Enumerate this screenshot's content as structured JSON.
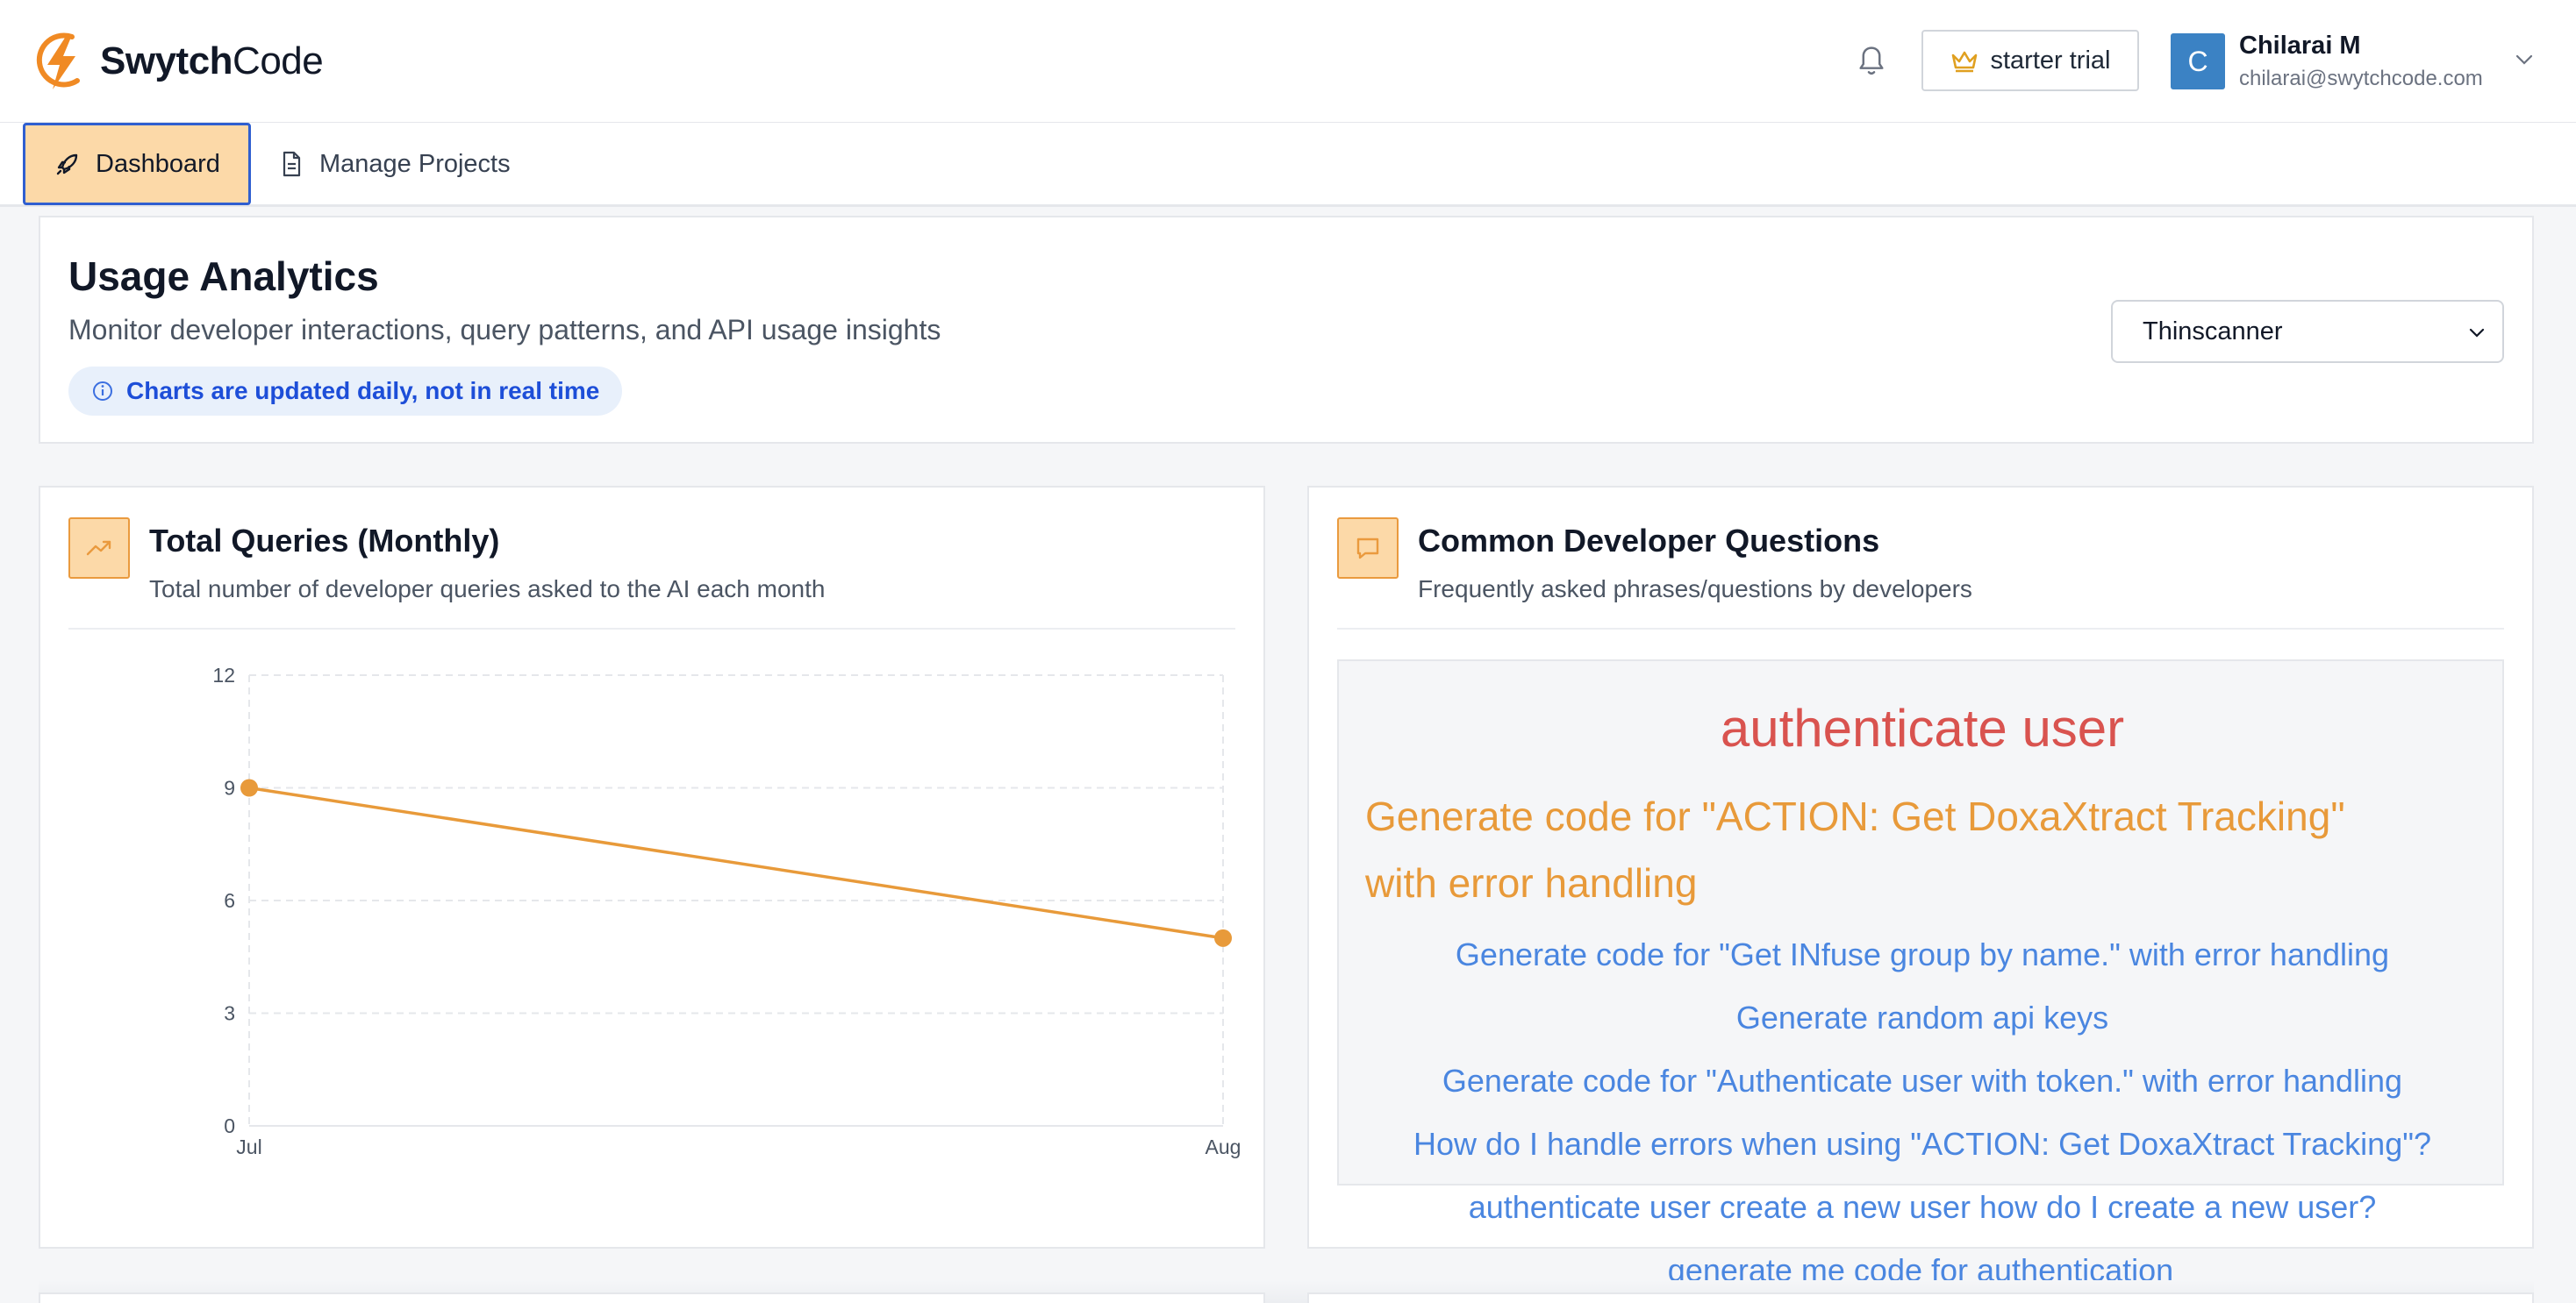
{
  "brand": {
    "name_bold": "Swytch",
    "name_rest": "Code",
    "logo_icon": "lightning-bolt-logo",
    "accent": "#f08a24"
  },
  "header": {
    "bell_icon": "bell-icon",
    "trial_label": "starter trial",
    "trial_icon": "crown-icon",
    "user": {
      "initial": "C",
      "name": "Chilarai M",
      "email": "chilarai@swytchcode.com"
    }
  },
  "nav": {
    "tabs": [
      {
        "label": "Dashboard",
        "icon": "rocket-icon",
        "active": true
      },
      {
        "label": "Manage Projects",
        "icon": "document-icon",
        "active": false
      }
    ]
  },
  "usage": {
    "title": "Usage Analytics",
    "subtitle": "Monitor developer interactions, query patterns, and API usage insights",
    "notice": "Charts are updated daily, not in real time",
    "project_select": "Thinscanner"
  },
  "queries_panel": {
    "title": "Total Queries (Monthly)",
    "subtitle": "Total number of developer queries asked to the AI each month",
    "icon": "trending-up-icon"
  },
  "questions_panel": {
    "title": "Common Developer Questions",
    "subtitle": "Frequently asked phrases/questions by developers",
    "icon": "chat-bubble-icon",
    "phrases": [
      {
        "text": "authenticate user",
        "color": "#d9534f"
      },
      {
        "text": "Generate code for \"ACTION: Get DoxaXtract Tracking\"",
        "color": "#e89a3a"
      },
      {
        "text": "with error handling",
        "color": "#e89a3a"
      },
      {
        "text": "Generate code for \"Get INfuse group by name.\" with error handling",
        "color": "#4a86e0"
      },
      {
        "text": "Generate random api keys",
        "color": "#4a86e0"
      },
      {
        "text": "Generate code for \"Authenticate user with token.\" with error handling",
        "color": "#4a86e0"
      },
      {
        "text": "How do I handle errors when using \"ACTION: Get DoxaXtract Tracking\"?",
        "color": "#4a86e0"
      },
      {
        "text": "authenticate user  create a new user  how do I create a new user?",
        "color": "#4a86e0"
      },
      {
        "text": "generate me code for authentication",
        "color": "#4a86e0"
      }
    ]
  },
  "chart_data": {
    "type": "line",
    "categories": [
      "Jul",
      "Aug"
    ],
    "series": [
      {
        "values": [
          9,
          5
        ],
        "color": "#e89a3a"
      }
    ],
    "yticks": [
      0,
      3,
      6,
      9,
      12
    ],
    "ylim": [
      0,
      12
    ],
    "grid": true,
    "title": "",
    "xlabel": "",
    "ylabel": ""
  }
}
